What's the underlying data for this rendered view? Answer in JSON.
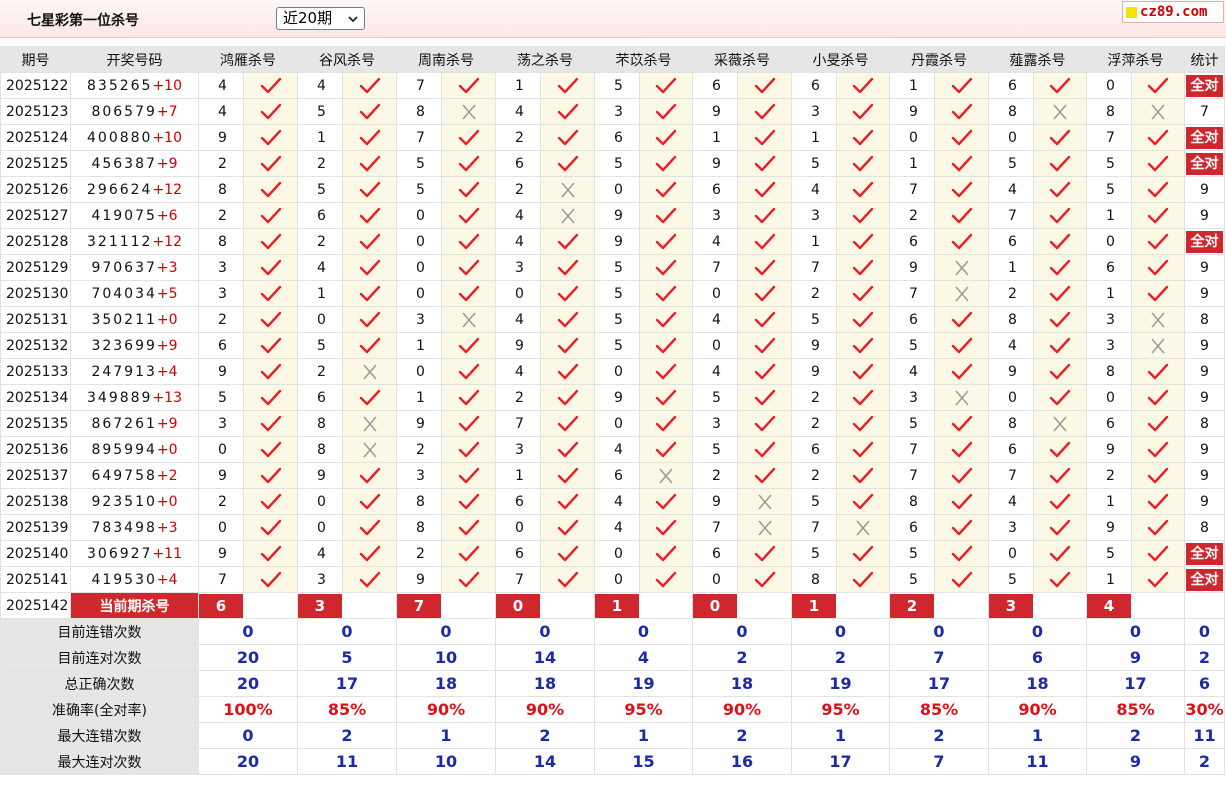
{
  "header": {
    "title": "七星彩第一位杀号",
    "period_select": "近20期",
    "logo_text": "cz89.com"
  },
  "columns": {
    "issue": "期号",
    "draw": "开奖号码",
    "stat": "统计",
    "experts": [
      "鸿雁杀号",
      "谷风杀号",
      "周南杀号",
      "荡之杀号",
      "芣苡杀号",
      "采薇杀号",
      "小旻杀号",
      "丹霞杀号",
      "薤露杀号",
      "浮萍杀号"
    ]
  },
  "colors": {
    "accent_red": "#d0272e",
    "value_blue": "#1c2aa8",
    "mark_bg": "#fbf8e6"
  },
  "rows": [
    {
      "issue": "2025122",
      "draw": "835265",
      "plus": "+10",
      "picks": [
        "4",
        "4",
        "7",
        "1",
        "5",
        "6",
        "6",
        "1",
        "6",
        "0"
      ],
      "hits": [
        1,
        1,
        1,
        1,
        1,
        1,
        1,
        1,
        1,
        1
      ],
      "stat": "全对",
      "allok": true
    },
    {
      "issue": "2025123",
      "draw": "806579",
      "plus": "+7",
      "picks": [
        "4",
        "5",
        "8",
        "4",
        "3",
        "9",
        "3",
        "9",
        "8",
        "8"
      ],
      "hits": [
        1,
        1,
        0,
        1,
        1,
        1,
        1,
        1,
        0,
        0
      ],
      "stat": "7",
      "allok": false
    },
    {
      "issue": "2025124",
      "draw": "400880",
      "plus": "+10",
      "picks": [
        "9",
        "1",
        "7",
        "2",
        "6",
        "1",
        "1",
        "0",
        "0",
        "7"
      ],
      "hits": [
        1,
        1,
        1,
        1,
        1,
        1,
        1,
        1,
        1,
        1
      ],
      "stat": "全对",
      "allok": true
    },
    {
      "issue": "2025125",
      "draw": "456387",
      "plus": "+9",
      "picks": [
        "2",
        "2",
        "5",
        "6",
        "5",
        "9",
        "5",
        "1",
        "5",
        "5"
      ],
      "hits": [
        1,
        1,
        1,
        1,
        1,
        1,
        1,
        1,
        1,
        1
      ],
      "stat": "全对",
      "allok": true
    },
    {
      "issue": "2025126",
      "draw": "296624",
      "plus": "+12",
      "picks": [
        "8",
        "5",
        "5",
        "2",
        "0",
        "6",
        "4",
        "7",
        "4",
        "5"
      ],
      "hits": [
        1,
        1,
        1,
        0,
        1,
        1,
        1,
        1,
        1,
        1
      ],
      "stat": "9",
      "allok": false
    },
    {
      "issue": "2025127",
      "draw": "419075",
      "plus": "+6",
      "picks": [
        "2",
        "6",
        "0",
        "4",
        "9",
        "3",
        "3",
        "2",
        "7",
        "1"
      ],
      "hits": [
        1,
        1,
        1,
        0,
        1,
        1,
        1,
        1,
        1,
        1
      ],
      "stat": "9",
      "allok": false
    },
    {
      "issue": "2025128",
      "draw": "321112",
      "plus": "+12",
      "picks": [
        "8",
        "2",
        "0",
        "4",
        "9",
        "4",
        "1",
        "6",
        "6",
        "0"
      ],
      "hits": [
        1,
        1,
        1,
        1,
        1,
        1,
        1,
        1,
        1,
        1
      ],
      "stat": "全对",
      "allok": true
    },
    {
      "issue": "2025129",
      "draw": "970637",
      "plus": "+3",
      "picks": [
        "3",
        "4",
        "0",
        "3",
        "5",
        "7",
        "7",
        "9",
        "1",
        "6"
      ],
      "hits": [
        1,
        1,
        1,
        1,
        1,
        1,
        1,
        0,
        1,
        1
      ],
      "stat": "9",
      "allok": false
    },
    {
      "issue": "2025130",
      "draw": "704034",
      "plus": "+5",
      "picks": [
        "3",
        "1",
        "0",
        "0",
        "5",
        "0",
        "2",
        "7",
        "2",
        "1"
      ],
      "hits": [
        1,
        1,
        1,
        1,
        1,
        1,
        1,
        0,
        1,
        1
      ],
      "stat": "9",
      "allok": false
    },
    {
      "issue": "2025131",
      "draw": "350211",
      "plus": "+0",
      "picks": [
        "2",
        "0",
        "3",
        "4",
        "5",
        "4",
        "5",
        "6",
        "8",
        "3"
      ],
      "hits": [
        1,
        1,
        0,
        1,
        1,
        1,
        1,
        1,
        1,
        0
      ],
      "stat": "8",
      "allok": false
    },
    {
      "issue": "2025132",
      "draw": "323699",
      "plus": "+9",
      "picks": [
        "6",
        "5",
        "1",
        "9",
        "5",
        "0",
        "9",
        "5",
        "4",
        "3"
      ],
      "hits": [
        1,
        1,
        1,
        1,
        1,
        1,
        1,
        1,
        1,
        0
      ],
      "stat": "9",
      "allok": false
    },
    {
      "issue": "2025133",
      "draw": "247913",
      "plus": "+4",
      "picks": [
        "9",
        "2",
        "0",
        "4",
        "0",
        "4",
        "9",
        "4",
        "9",
        "8"
      ],
      "hits": [
        1,
        0,
        1,
        1,
        1,
        1,
        1,
        1,
        1,
        1
      ],
      "stat": "9",
      "allok": false
    },
    {
      "issue": "2025134",
      "draw": "349889",
      "plus": "+13",
      "picks": [
        "5",
        "6",
        "1",
        "2",
        "9",
        "5",
        "2",
        "3",
        "0",
        "0"
      ],
      "hits": [
        1,
        1,
        1,
        1,
        1,
        1,
        1,
        0,
        1,
        1
      ],
      "stat": "9",
      "allok": false
    },
    {
      "issue": "2025135",
      "draw": "867261",
      "plus": "+9",
      "picks": [
        "3",
        "8",
        "9",
        "7",
        "0",
        "3",
        "2",
        "5",
        "8",
        "6"
      ],
      "hits": [
        1,
        0,
        1,
        1,
        1,
        1,
        1,
        1,
        0,
        1
      ],
      "stat": "8",
      "allok": false
    },
    {
      "issue": "2025136",
      "draw": "895994",
      "plus": "+0",
      "picks": [
        "0",
        "8",
        "2",
        "3",
        "4",
        "5",
        "6",
        "7",
        "6",
        "9"
      ],
      "hits": [
        1,
        0,
        1,
        1,
        1,
        1,
        1,
        1,
        1,
        1
      ],
      "stat": "9",
      "allok": false
    },
    {
      "issue": "2025137",
      "draw": "649758",
      "plus": "+2",
      "picks": [
        "9",
        "9",
        "3",
        "1",
        "6",
        "2",
        "2",
        "7",
        "7",
        "2"
      ],
      "hits": [
        1,
        1,
        1,
        1,
        0,
        1,
        1,
        1,
        1,
        1
      ],
      "stat": "9",
      "allok": false
    },
    {
      "issue": "2025138",
      "draw": "923510",
      "plus": "+0",
      "picks": [
        "2",
        "0",
        "8",
        "6",
        "4",
        "9",
        "5",
        "8",
        "4",
        "1"
      ],
      "hits": [
        1,
        1,
        1,
        1,
        1,
        0,
        1,
        1,
        1,
        1
      ],
      "stat": "9",
      "allok": false
    },
    {
      "issue": "2025139",
      "draw": "783498",
      "plus": "+3",
      "picks": [
        "0",
        "0",
        "8",
        "0",
        "4",
        "7",
        "7",
        "6",
        "3",
        "9"
      ],
      "hits": [
        1,
        1,
        1,
        1,
        1,
        0,
        0,
        1,
        1,
        1
      ],
      "stat": "8",
      "allok": false
    },
    {
      "issue": "2025140",
      "draw": "306927",
      "plus": "+11",
      "picks": [
        "9",
        "4",
        "2",
        "6",
        "0",
        "6",
        "5",
        "5",
        "0",
        "5"
      ],
      "hits": [
        1,
        1,
        1,
        1,
        1,
        1,
        1,
        1,
        1,
        1
      ],
      "stat": "全对",
      "allok": true
    },
    {
      "issue": "2025141",
      "draw": "419530",
      "plus": "+4",
      "picks": [
        "7",
        "3",
        "9",
        "7",
        "0",
        "0",
        "8",
        "5",
        "5",
        "1"
      ],
      "hits": [
        1,
        1,
        1,
        1,
        1,
        1,
        1,
        1,
        1,
        1
      ],
      "stat": "全对",
      "allok": true
    }
  ],
  "current": {
    "issue": "2025142",
    "label": "当前期杀号",
    "picks": [
      "6",
      "3",
      "7",
      "0",
      "1",
      "0",
      "1",
      "2",
      "3",
      "4"
    ]
  },
  "summary": [
    {
      "label": "目前连错次数",
      "values": [
        "0",
        "0",
        "0",
        "0",
        "0",
        "0",
        "0",
        "0",
        "0",
        "0"
      ],
      "stat": "0",
      "red": false
    },
    {
      "label": "目前连对次数",
      "values": [
        "20",
        "5",
        "10",
        "14",
        "4",
        "2",
        "2",
        "7",
        "6",
        "9"
      ],
      "stat": "2",
      "red": false
    },
    {
      "label": "总正确次数",
      "values": [
        "20",
        "17",
        "18",
        "18",
        "19",
        "18",
        "19",
        "17",
        "18",
        "17"
      ],
      "stat": "6",
      "red": false
    },
    {
      "label": "准确率(全对率)",
      "values": [
        "100%",
        "85%",
        "90%",
        "90%",
        "95%",
        "90%",
        "95%",
        "85%",
        "90%",
        "85%"
      ],
      "stat": "30%",
      "red": true
    },
    {
      "label": "最大连错次数",
      "values": [
        "0",
        "2",
        "1",
        "2",
        "1",
        "2",
        "1",
        "2",
        "1",
        "2"
      ],
      "stat": "11",
      "red": false
    },
    {
      "label": "最大连对次数",
      "values": [
        "20",
        "11",
        "10",
        "14",
        "15",
        "16",
        "17",
        "7",
        "11",
        "9"
      ],
      "stat": "2",
      "red": false
    }
  ]
}
